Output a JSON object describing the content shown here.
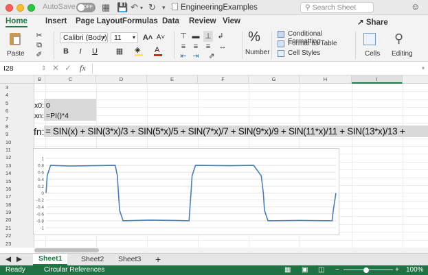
{
  "titlebar": {
    "autosave_label": "AutoSave",
    "toggle_label": "OFF",
    "doc_title": "EngineeringExamples",
    "search_placeholder": "Search Sheet"
  },
  "ribbon_tabs": [
    "Home",
    "Insert",
    "Page Layout",
    "Formulas",
    "Data",
    "Review",
    "View"
  ],
  "active_tab": "Home",
  "share_label": "Share",
  "ribbon": {
    "paste_label": "Paste",
    "font_name": "Calibri (Body)",
    "font_size": "11",
    "bold": "B",
    "italic": "I",
    "underline": "U",
    "number_label": "Number",
    "percent": "%",
    "conditional_formatting": "Conditional Formatting",
    "format_as_table": "Format as Table",
    "cell_styles": "Cell Styles",
    "cells_label": "Cells",
    "editing_label": "Editing"
  },
  "formula_bar": {
    "name_box": "I28",
    "fx": "fx",
    "content": ""
  },
  "columns": [
    "B",
    "C",
    "D",
    "E",
    "F",
    "G",
    "H",
    "I"
  ],
  "selected_column": "I",
  "rows": [
    "3",
    "4",
    "5",
    "6",
    "7",
    "8",
    "9",
    "10",
    "11",
    "12",
    "13",
    "14",
    "15",
    "16",
    "17",
    "18",
    "19",
    "20",
    "21",
    "22",
    "23"
  ],
  "cells": {
    "x0_label": "x0:",
    "x0_value": "0",
    "xn_label": "xn:",
    "xn_value": "=PI()*4",
    "fn_label": "fn:",
    "fn_value": "= SIN(x) + SIN(3*x)/3  + SIN(5*x)/5  + SIN(7*x)/7  + SIN(9*x)/9  + SIN(11*x)/11  + SIN(13*x)/13  +"
  },
  "chart_data": {
    "type": "line",
    "title": "",
    "yticks": [
      "1",
      "0.8",
      "0.6",
      "0.4",
      "0.2",
      "0",
      "-0.2",
      "-0.4",
      "-0.6",
      "-0.8",
      "-1"
    ],
    "ylim": [
      -1,
      1
    ],
    "x_range": [
      0,
      12.566
    ],
    "grid": true,
    "series": [
      {
        "color": "#4a7ebb",
        "description": "Fourier partial sum of square wave, period 2pi, amplitude ~0.785",
        "x": [
          0,
          0.05,
          0.2,
          1.0,
          2.0,
          3.0,
          3.09,
          3.14,
          3.19,
          3.34,
          4.5,
          5.5,
          6.2,
          6.23,
          6.283,
          6.33,
          6.48,
          8.0,
          9.0,
          9.33,
          9.42,
          9.47,
          9.62,
          11.0,
          12.4,
          12.45,
          12.566
        ],
        "y": [
          0,
          0.5,
          0.8,
          0.78,
          0.79,
          0.8,
          0.5,
          0,
          -0.5,
          -0.8,
          -0.78,
          -0.79,
          -0.8,
          -0.5,
          0,
          0.5,
          0.8,
          0.79,
          0.8,
          0.5,
          0,
          -0.5,
          -0.8,
          -0.79,
          -0.8,
          -0.5,
          0
        ]
      }
    ]
  },
  "sheets": [
    "Sheet1",
    "Sheet2",
    "Sheet3"
  ],
  "active_sheet": "Sheet1",
  "add_sheet": "+",
  "status": {
    "ready": "Ready",
    "circular": "Circular References",
    "zoom": "100%"
  },
  "colors": {
    "excel_green": "#1d7a45",
    "status_green": "#1f7244",
    "series_blue": "#4a7ebb"
  }
}
